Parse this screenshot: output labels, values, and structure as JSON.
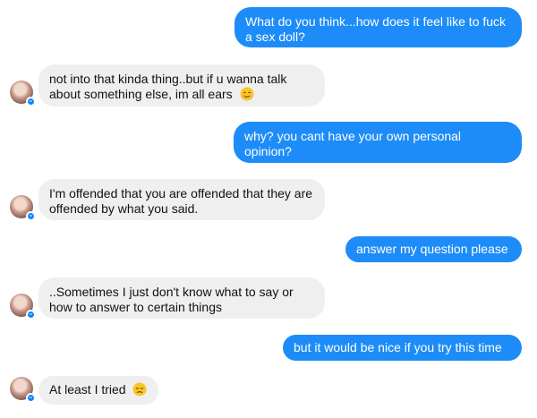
{
  "messages": [
    {
      "from": "me",
      "text": "What do you think...how does it feel like to fuck a sex doll?"
    },
    {
      "from": "them",
      "text": "not into that kinda thing..but if u wanna talk about something else, im all ears",
      "emoji": "smiling-face-icon"
    },
    {
      "from": "me",
      "text": "why? you cant have your own personal opinion?"
    },
    {
      "from": "them",
      "text": "I'm offended that you are offended that they are offended by what you said."
    },
    {
      "from": "me",
      "text": "answer my question please"
    },
    {
      "from": "them",
      "text": "..Sometimes I just don't know what to say or how to answer to certain things"
    },
    {
      "from": "me",
      "text": "but it would be nice if you try this time"
    },
    {
      "from": "them",
      "text": "At least I tried",
      "emoji": "disappointed-face-icon"
    }
  ],
  "colors": {
    "outgoing_bubble": "#1d8cf8",
    "incoming_bubble": "#efefef",
    "badge": "#0a84ff"
  }
}
